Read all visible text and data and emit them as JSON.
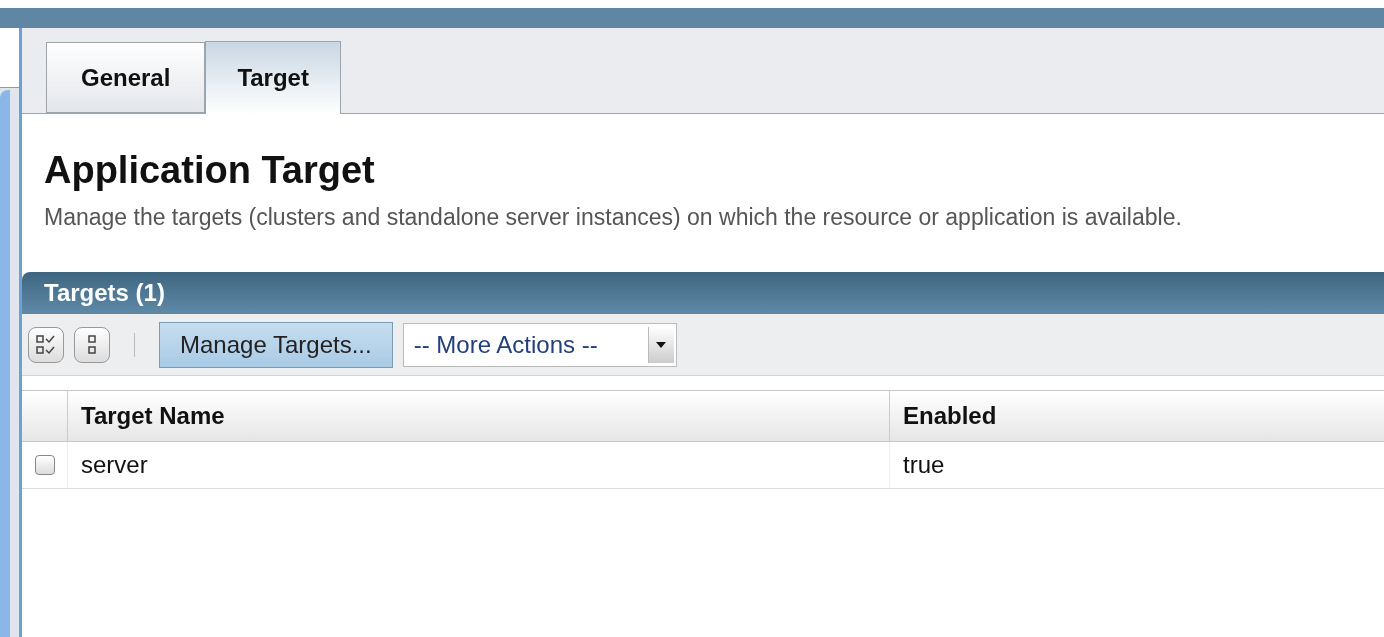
{
  "tabs": [
    {
      "label": "General",
      "selected": false
    },
    {
      "label": "Target",
      "selected": true
    }
  ],
  "page": {
    "title": "Application Target",
    "description": "Manage the targets (clusters and standalone server instances) on which the resource or application is available."
  },
  "table": {
    "title": "Targets (1)",
    "toolbar": {
      "button": "Manage Targets...",
      "dropdown": "-- More Actions --"
    },
    "columns": [
      "Target Name",
      "Enabled"
    ],
    "rows": [
      {
        "checked": false,
        "cells": [
          "server",
          "true"
        ]
      }
    ]
  }
}
